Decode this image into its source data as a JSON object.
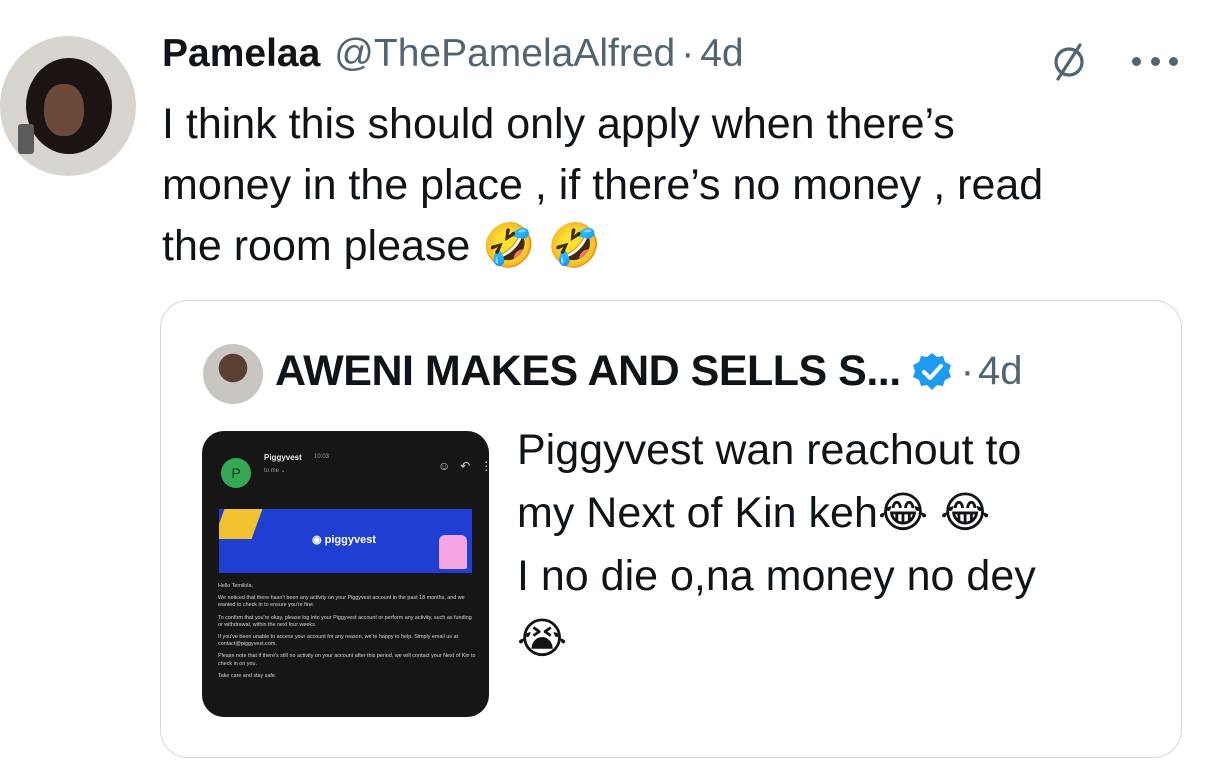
{
  "tweet": {
    "author_name": "Pamelaa",
    "author_handle": "@ThePamelaAlfred",
    "separator": "·",
    "time": "4d",
    "text_lines": [
      "I think this should only apply when there’s",
      "money in the place , if there’s no money , read",
      "the room please 🤣 🤣"
    ],
    "icons": {
      "grok": "grok-icon",
      "more": "more-icon"
    }
  },
  "quoted_tweet": {
    "author_name": "AWENI MAKES AND SELLS S...",
    "verified_color": "#1d9bf0",
    "separator": "·",
    "time": "4d",
    "text_lines": [
      "Piggyvest wan reachout to",
      "my Next of Kin keh😂 😂",
      "I no die o,na money no dey",
      "😭"
    ],
    "image": {
      "sender_initial": "P",
      "sender": "Piggyvest",
      "sent_time": "10:03",
      "to": "to me ⌄",
      "logo_text": "piggyvest",
      "greeting": "Hello Temilola,",
      "paragraph_1": "We noticed that there hasn't been any activity on your Piggyvest account in the past 18 months, and we wanted to check in to ensure you're fine.",
      "paragraph_2": "To confirm that you're okay, please log into your Piggyvest account or perform any activity, such as funding or withdrawal, within the next four weeks.",
      "paragraph_3": "If you've been unable to access your account for any reason, we're happy to help. Simply email us at contact@piggyvest.com.",
      "paragraph_4": "Please note that if there's still no activity on your account after this period, we will contact your Next of Kin to check in on you.",
      "closing": "Take care and stay safe."
    }
  },
  "colors": {
    "text_primary": "#0f1419",
    "text_secondary": "#536471",
    "border": "#cfd9de",
    "banner_blue": "#1e3fd1"
  }
}
